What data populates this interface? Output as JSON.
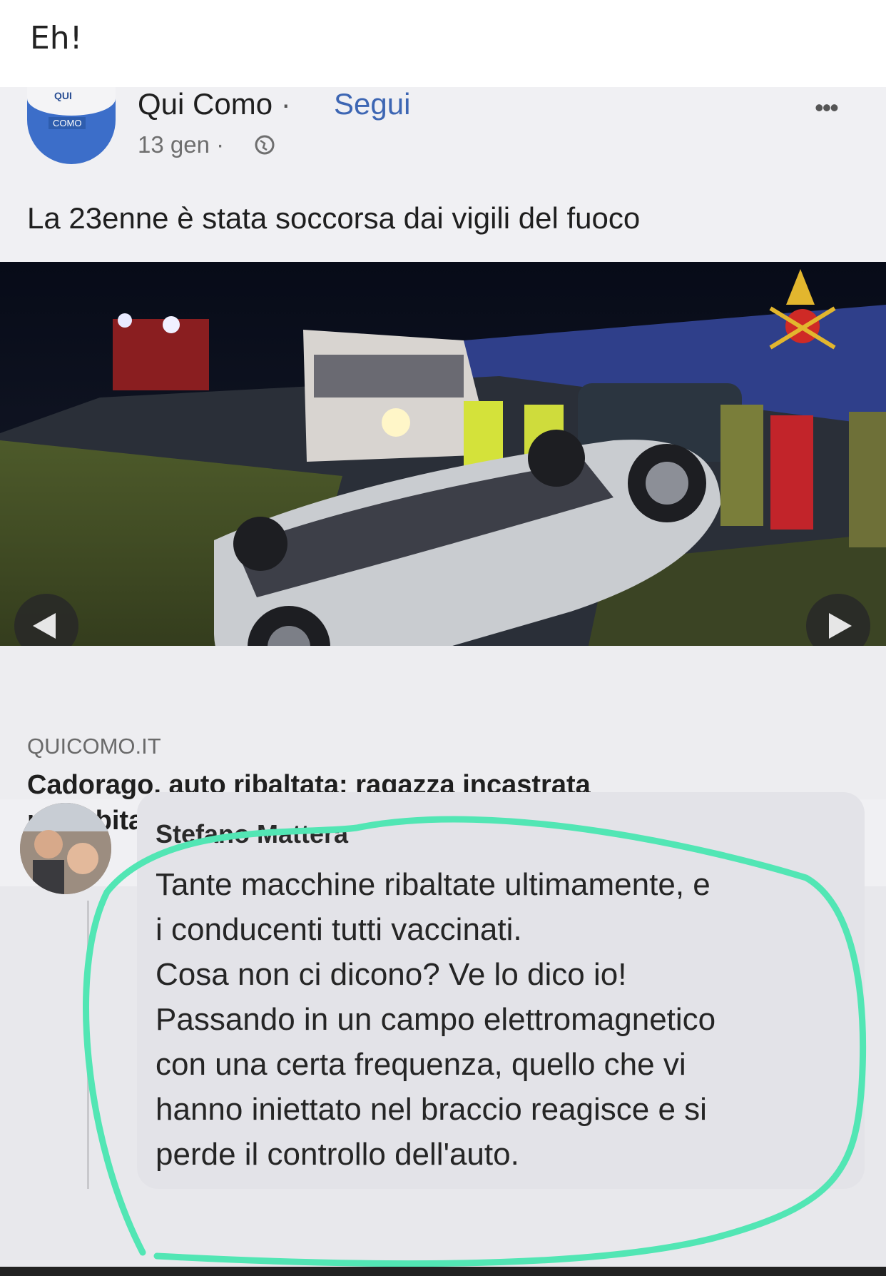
{
  "caption": "Eh!",
  "post": {
    "page_name": "Qui Como",
    "separator": "·",
    "follow_label": "Segui",
    "date": "13 gen ·",
    "avatar_top": "QUI",
    "avatar_bottom": "COMO",
    "more_label": "•••",
    "text": "La 23enne è stata soccorsa dai vigili del fuoco"
  },
  "link_preview": {
    "domain": "QUICOMO.IT",
    "title": "Cadorago, auto ribaltata: ragazza incastrata nell'abitacolo"
  },
  "comment": {
    "author": "Stefano Mattera",
    "lines": [
      "Tante macchine ribaltate ultimamente, e",
      "i conducenti tutti vaccinati.",
      "Cosa non ci dicono? Ve lo dico io!",
      "Passando in un campo elettromagnetico",
      "con una certa frequenza, quello che vi",
      "hanno iniettato nel braccio reagisce e si",
      "perde il controllo dell'auto."
    ]
  },
  "colors": {
    "link_blue": "#3d66b3",
    "highlight_green": "#52e6b4"
  },
  "icons": [
    "globe-icon",
    "more-icon",
    "prev-arrow-icon",
    "next-arrow-icon"
  ]
}
